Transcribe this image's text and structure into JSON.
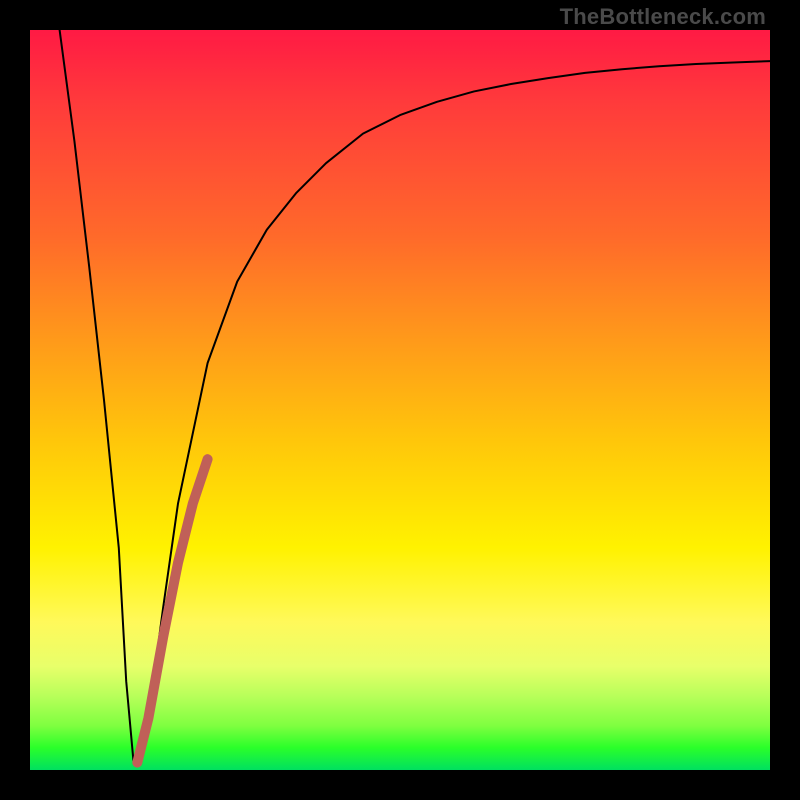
{
  "watermark": "TheBottleneck.com",
  "chart_data": {
    "type": "line",
    "title": "",
    "xlabel": "",
    "ylabel": "",
    "xlim": [
      0,
      100
    ],
    "ylim": [
      0,
      100
    ],
    "series": [
      {
        "name": "bottleneck-curve",
        "color": "#000000",
        "width": 2,
        "x": [
          4,
          6,
          8,
          10,
          12,
          13,
          14,
          15,
          16,
          18,
          20,
          24,
          28,
          32,
          36,
          40,
          45,
          50,
          55,
          60,
          65,
          70,
          75,
          80,
          85,
          90,
          95,
          100
        ],
        "y": [
          100,
          85,
          68,
          50,
          30,
          12,
          1,
          1,
          7,
          22,
          36,
          55,
          66,
          73,
          78,
          82,
          86,
          88.5,
          90.3,
          91.7,
          92.7,
          93.5,
          94.2,
          94.7,
          95.1,
          95.4,
          95.6,
          95.8
        ]
      },
      {
        "name": "highlight-segment",
        "color": "#c06058",
        "width": 10,
        "x": [
          14.5,
          16,
          18,
          20,
          22,
          24
        ],
        "y": [
          1,
          7,
          18,
          28,
          36,
          42
        ]
      }
    ]
  }
}
